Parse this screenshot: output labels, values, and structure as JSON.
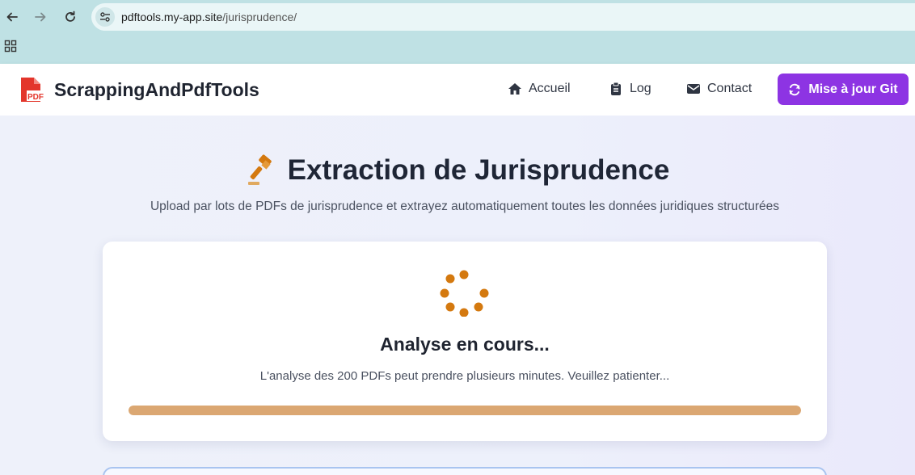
{
  "browser": {
    "url_host": "pdftools.my-app.site",
    "url_path": "/jurisprudence/"
  },
  "header": {
    "brand": "ScrappingAndPdfTools",
    "logo_badge": "PDF",
    "nav": {
      "home": "Accueil",
      "log": "Log",
      "contact": "Contact"
    },
    "git_button": "Mise à jour Git"
  },
  "main": {
    "title": "Extraction de Jurisprudence",
    "subtitle": "Upload par lots de PDFs de jurisprudence et extrayez automatiquement toutes les données juridiques structurées",
    "loading": {
      "title": "Analyse en cours...",
      "text": "L'analyse des 200 PDFs peut prendre plusieurs minutes. Veuillez patienter...",
      "progress_percent": 100
    }
  },
  "colors": {
    "accent": "#8d34e3",
    "spinner": "#d4790f",
    "progress": "#dba772",
    "logo": "#e3352b"
  }
}
